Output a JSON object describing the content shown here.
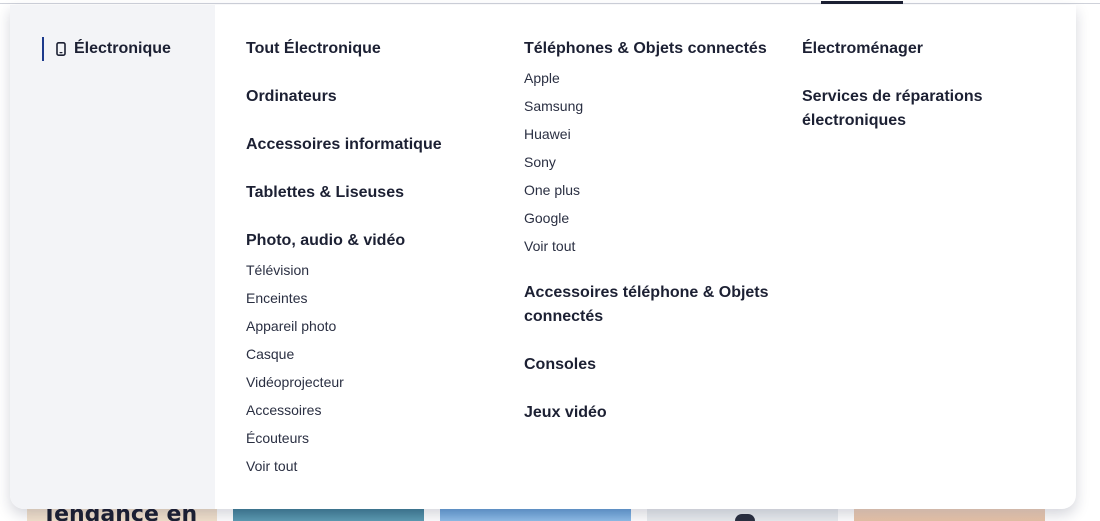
{
  "sidebar": {
    "items": [
      {
        "label": "Électronique",
        "icon": "smartphone-icon",
        "active": true
      }
    ]
  },
  "columns": {
    "col1": {
      "cat_all": "Tout Électronique",
      "cat_computers": "Ordinateurs",
      "cat_computer_accessories": "Accessoires informatique",
      "cat_tablets": "Tablettes & Liseuses",
      "cat_photo_audio_video": "Photo, audio & vidéo",
      "photo_audio_video_items": [
        "Télévision",
        "Enceintes",
        "Appareil photo",
        "Casque",
        "Vidéoprojecteur",
        "Accessoires",
        "Écouteurs",
        "Voir tout"
      ]
    },
    "col2": {
      "cat_phones": "Téléphones & Objets connectés",
      "phones_items": [
        "Apple",
        "Samsung",
        "Huawei",
        "Sony",
        "One plus",
        "Google",
        "Voir tout"
      ],
      "cat_phone_accessories_line1": "Accessoires téléphone & Objets",
      "cat_phone_accessories_line2": "connectés",
      "cat_consoles": "Consoles",
      "cat_video_games": "Jeux vidéo"
    },
    "col3": {
      "cat_appliances": "Électroménager",
      "cat_repairs_line1": "Services de réparations",
      "cat_repairs_line2": "électroniques"
    }
  },
  "background": {
    "heading": "Tendance en"
  },
  "colors": {
    "text": "#1c2033",
    "sidebar_bg": "#f3f4f7",
    "accent": "#1c3a8c"
  }
}
